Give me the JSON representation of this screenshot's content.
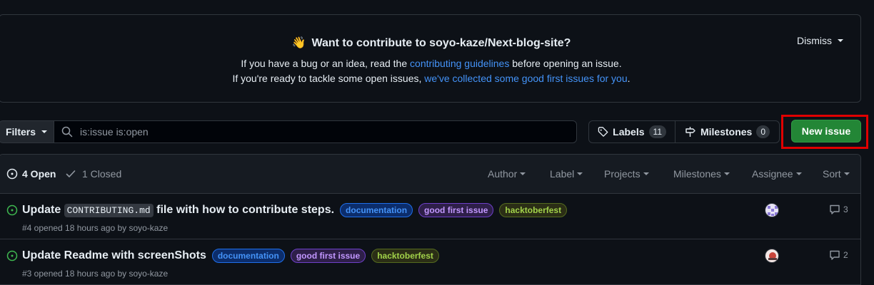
{
  "banner": {
    "emoji": "👋",
    "title": "Want to contribute to soyo-kaze/Next-blog-site?",
    "line1_prefix": "If you have a bug or an idea, read the ",
    "line1_link": "contributing guidelines",
    "line1_suffix": " before opening an issue.",
    "line2_prefix": "If you're ready to tackle some open issues, ",
    "line2_link": "we've collected some good first issues for you",
    "line2_suffix": ".",
    "dismiss_label": "Dismiss"
  },
  "toolbar": {
    "filters_label": "Filters",
    "search_value": "is:issue is:open",
    "labels_label": "Labels",
    "labels_count": "11",
    "milestones_label": "Milestones",
    "milestones_count": "0",
    "new_issue_label": "New issue"
  },
  "issue_list": {
    "open_label": "4 Open",
    "closed_label": "1 Closed",
    "sorters": [
      "Author",
      "Label",
      "Projects",
      "Milestones",
      "Assignee",
      "Sort"
    ],
    "issues": [
      {
        "title_prefix": "Update ",
        "title_code": "CONTRIBUTING.md",
        "title_suffix": " file with how to contribute steps.",
        "labels": [
          "documentation",
          "good first issue",
          "hacktoberfest"
        ],
        "meta": "#4 opened 18 hours ago by soyo-kaze",
        "comments": "3"
      },
      {
        "title": "Update Readme with screenShots",
        "labels": [
          "documentation",
          "good first issue",
          "hacktoberfest"
        ],
        "meta": "#3 opened 18 hours ago by soyo-kaze",
        "comments": "2"
      }
    ]
  },
  "colors": {
    "accent_link": "#4493f8",
    "primary_button": "#238636",
    "highlight_border": "#e00000",
    "open_icon": "#3fb950"
  }
}
